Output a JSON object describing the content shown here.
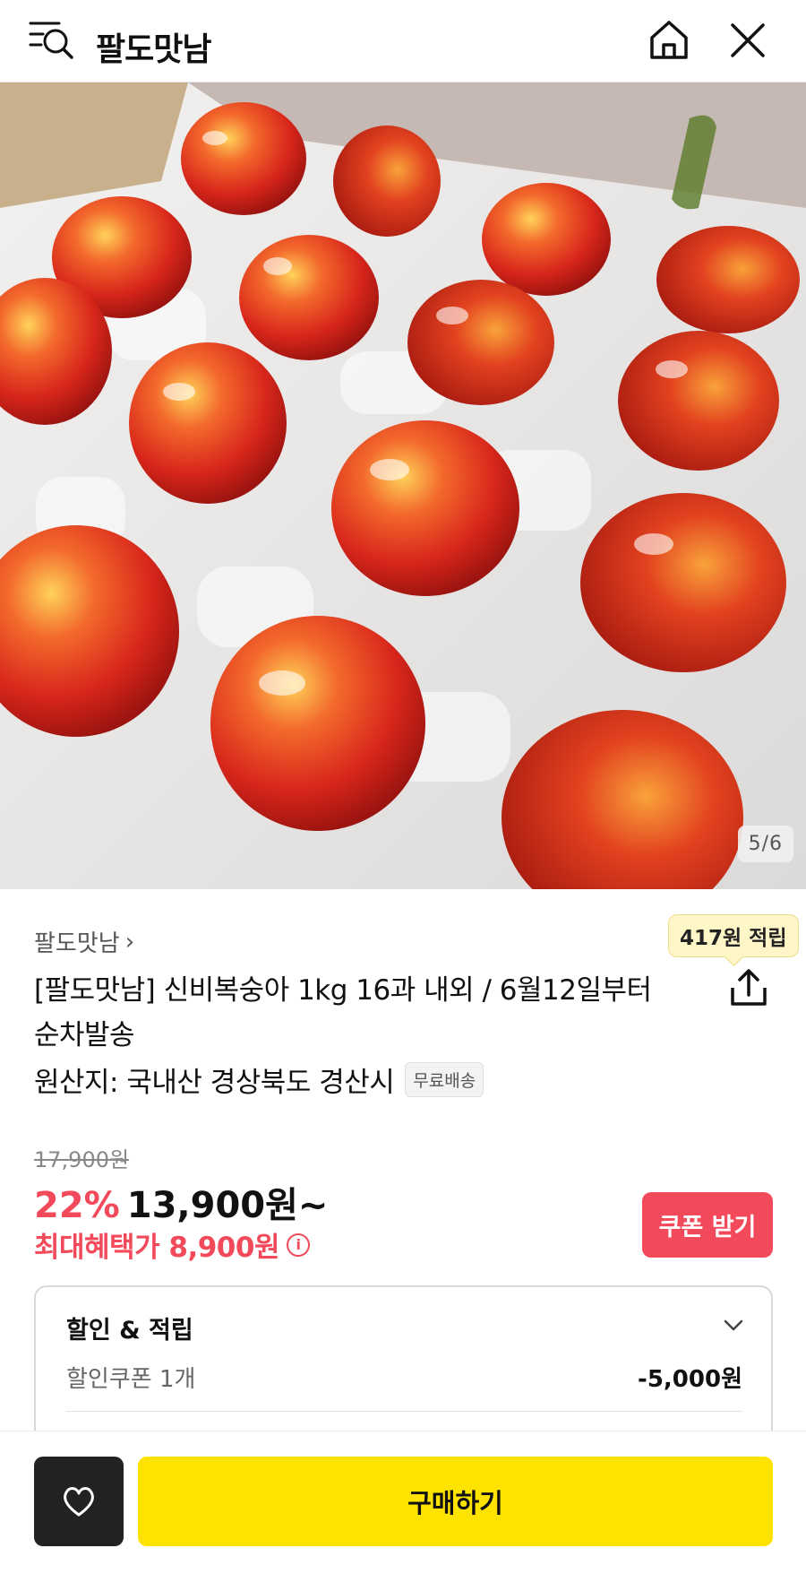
{
  "header": {
    "title": "팔도맛남",
    "menu_icon": "menu-search-icon",
    "home_icon": "home-icon",
    "close_icon": "close-icon"
  },
  "gallery": {
    "indicator": "5/6"
  },
  "product": {
    "seller": "팔도맛남",
    "reward_badge": "417원 적립",
    "name_line1": "[팔도맛남] 신비복숭아 1kg 16과 내외 / 6월12일부터",
    "name_line2": "순차발송",
    "origin": "원산지: 국내산 경상북도 경산시",
    "shipping_tag": "무료배송"
  },
  "pricing": {
    "original": "17,900원",
    "discount": "22%",
    "price": "13,900원~",
    "max_benefit": "최대혜택가 8,900원",
    "coupon_button": "쿠폰 받기"
  },
  "benefits": {
    "title": "할인 & 적립",
    "coupon_label": "할인쿠폰 1개",
    "coupon_value": "-5,000원"
  },
  "bottom_bar": {
    "buy_label": "구매하기"
  },
  "colors": {
    "accent_red": "#f24a5b",
    "buy_yellow": "#ffe300"
  }
}
